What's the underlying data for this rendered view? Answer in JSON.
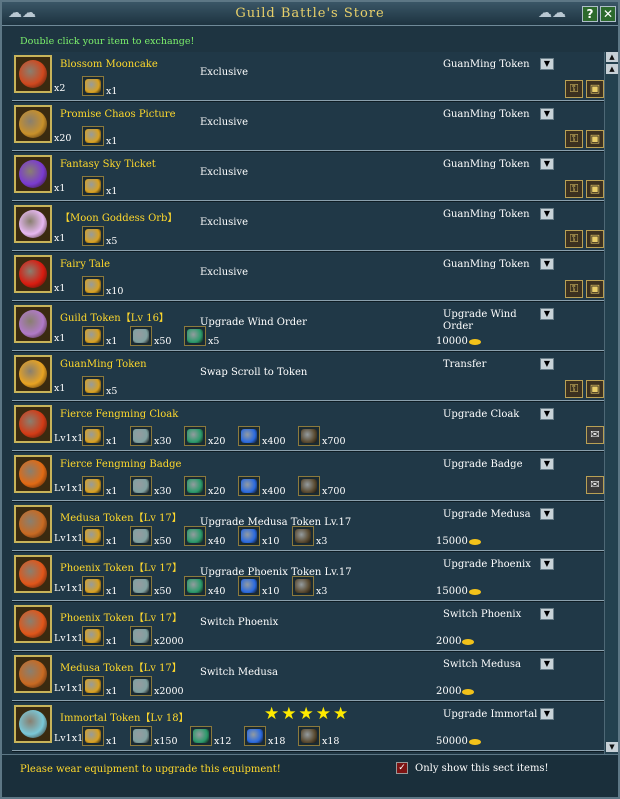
{
  "window": {
    "title": "Guild Battle's Store"
  },
  "hint": "Double click your item to exchange!",
  "footer": {
    "warning": "Please wear equipment to upgrade this equipment!",
    "filter_label": "Only show this sect items!",
    "filter_checked": true
  },
  "rows": [
    {
      "name": "Blossom Mooncake",
      "qty": "x2",
      "desc": "Exclusive",
      "option": "GuanMing Token",
      "mats": [
        "x1"
      ],
      "cost": "",
      "actions": "two",
      "color": "#d0481e"
    },
    {
      "name": "Promise Chaos Picture",
      "qty": "x20",
      "desc": "Exclusive",
      "option": "GuanMing Token",
      "mats": [
        "x1"
      ],
      "cost": "",
      "actions": "two",
      "color": "#c8902a"
    },
    {
      "name": "Fantasy Sky Ticket",
      "qty": "x1",
      "desc": "Exclusive",
      "option": "GuanMing Token",
      "mats": [
        "x1"
      ],
      "cost": "",
      "actions": "two",
      "color": "#7a3bd0"
    },
    {
      "name": "【Moon Goddess Orb】",
      "qty": "x1",
      "desc": "Exclusive",
      "option": "GuanMing Token",
      "mats": [
        "x5"
      ],
      "cost": "",
      "actions": "two",
      "color": "#e6b8f2"
    },
    {
      "name": "Fairy Tale",
      "qty": "x1",
      "desc": "Exclusive",
      "option": "GuanMing Token",
      "mats": [
        "x10"
      ],
      "cost": "",
      "actions": "two",
      "color": "#d81c10"
    },
    {
      "name": "Guild Token【Lv 16】",
      "qty": "x1",
      "desc": "Upgrade Wind Order",
      "option": "Upgrade Wind Order",
      "mats": [
        "x1",
        "x50",
        "x5"
      ],
      "cost": "10000",
      "actions": "none",
      "color": "#b07ac8"
    },
    {
      "name": "GuanMing Token",
      "qty": "x1",
      "desc": "Swap Scroll to Token",
      "option": "Transfer",
      "mats": [
        "x5"
      ],
      "cost": "",
      "actions": "two",
      "color": "#e8a322"
    },
    {
      "name": "Fierce Fengming Cloak",
      "qty": "Lv1x1",
      "desc": "",
      "option": "Upgrade Cloak",
      "mats": [
        "x1",
        "x30",
        "x20",
        "x400",
        "x700"
      ],
      "cost": "",
      "actions": "one",
      "color": "#d23b16"
    },
    {
      "name": "Fierce Fengming Badge",
      "qty": "Lv1x1",
      "desc": "",
      "option": "Upgrade Badge",
      "mats": [
        "x1",
        "x30",
        "x20",
        "x400",
        "x700"
      ],
      "cost": "",
      "actions": "one",
      "color": "#e06a14"
    },
    {
      "name": "Medusa Token【Lv 17】",
      "qty": "Lv1x1",
      "desc": "Upgrade Medusa Token Lv.17",
      "option": "Upgrade Medusa",
      "mats": [
        "x1",
        "x50",
        "x40",
        "x10",
        "x3"
      ],
      "cost": "15000",
      "actions": "none",
      "color": "#c86a22"
    },
    {
      "name": "Phoenix Token【Lv 17】",
      "qty": "Lv1x1",
      "desc": "Upgrade Phoenix Token Lv.17",
      "option": "Upgrade Phoenix",
      "mats": [
        "x1",
        "x50",
        "x40",
        "x10",
        "x3"
      ],
      "cost": "15000",
      "actions": "none",
      "color": "#e0561a"
    },
    {
      "name": "Phoenix Token【Lv 17】",
      "qty": "Lv1x1",
      "desc": "Switch Phoenix",
      "option": "Switch Phoenix",
      "mats": [
        "x1",
        "x2000"
      ],
      "cost": "2000",
      "actions": "none",
      "color": "#e0561a"
    },
    {
      "name": "Medusa Token【Lv 17】",
      "qty": "Lv1x1",
      "desc": "Switch Medusa",
      "option": "Switch Medusa",
      "mats": [
        "x1",
        "x2000"
      ],
      "cost": "2000",
      "actions": "none",
      "color": "#c86a22"
    },
    {
      "name": "Immortal Token【Lv 18】",
      "qty": "Lv1x1",
      "desc": "",
      "option": "Upgrade Immortal",
      "mats": [
        "x1",
        "x150",
        "x12",
        "x18",
        "x18"
      ],
      "cost": "50000",
      "actions": "none",
      "color": "#7ac8d8",
      "stars": "★★★★★"
    }
  ]
}
